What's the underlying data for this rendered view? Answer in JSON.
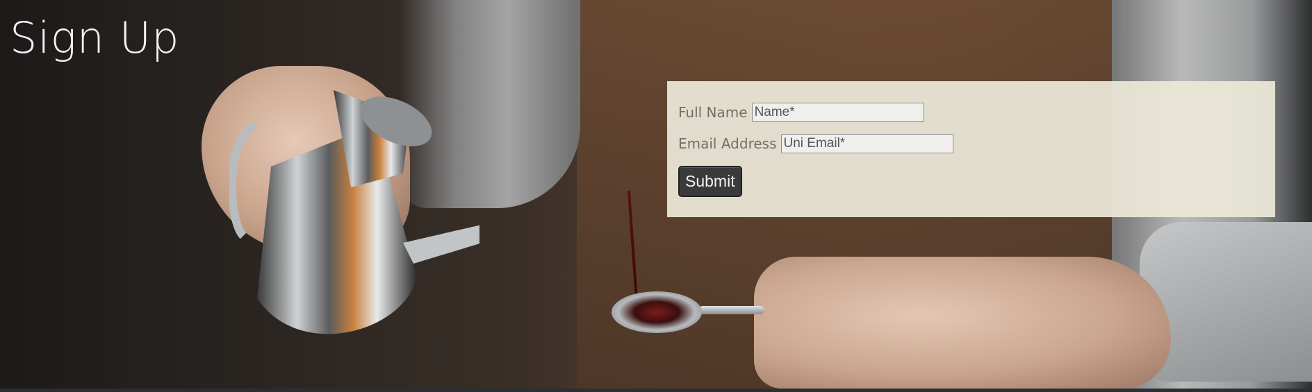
{
  "header": {
    "title": "Sign Up"
  },
  "form": {
    "full_name_label": "Full Name",
    "full_name_placeholder": "Name*",
    "email_label": "Email Address",
    "email_placeholder": "Uni Email*",
    "submit_label": "Submit"
  },
  "colors": {
    "form_panel_bg": "#ece8d8",
    "submit_bg": "#3a3a3a",
    "title_color": "#f2f2f2"
  }
}
